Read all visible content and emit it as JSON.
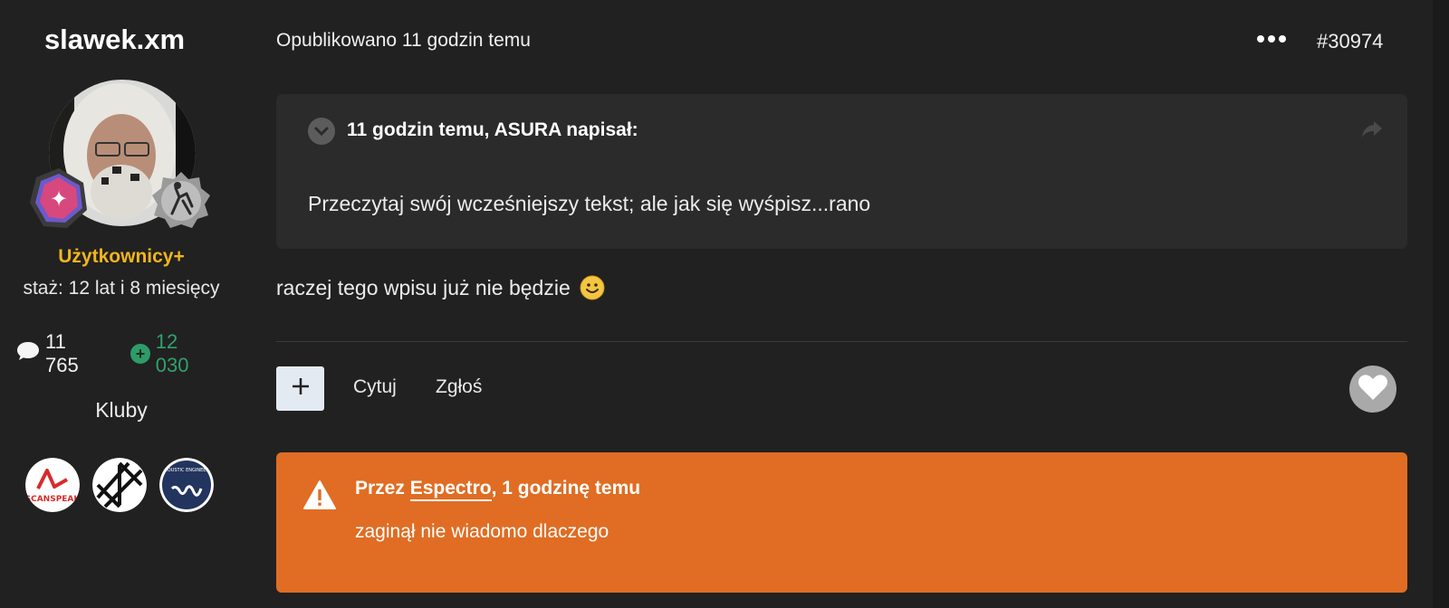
{
  "author": {
    "name": "slawek.xm",
    "group": "Użytkownicy+",
    "seniority": "staż: 12 lat i 8 miesięcy",
    "posts_count": "11 765",
    "reputation": "12 030",
    "clubs_title": "Kluby",
    "clubs": [
      {
        "name": "SCANSPEAK",
        "icon": "scanspeak-logo"
      },
      {
        "name": "",
        "icon": "star-lines-logo"
      },
      {
        "name": "ACOUSTIC ENGINEERS",
        "icon": "acoustic-engineers-logo"
      }
    ],
    "badges": [
      "celebration-badge",
      "rocker-badge"
    ]
  },
  "post": {
    "meta": "Opublikowano 11 godzin temu",
    "number": "#30974",
    "quote": {
      "header": "11 godzin temu, ASURA napisał:",
      "text": "Przeczytaj swój wcześniejszy tekst; ale jak się wyśpisz...rano"
    },
    "body": "raczej tego wpisu już nie będzie",
    "actions": {
      "add": "+",
      "quote_label": "Cytuj",
      "report_label": "Zgłoś"
    },
    "moderation": {
      "prefix": "Przez",
      "user": "Espectro",
      "suffix": ", 1 godzinę temu",
      "text": "zaginął nie wiadomo dlaczego"
    }
  },
  "colors": {
    "background": "#212121",
    "quote_bg": "#2b2b2b",
    "group_color": "#f1b51c",
    "reputation_color": "#31a06d",
    "moderation_bg": "#e06d23"
  }
}
